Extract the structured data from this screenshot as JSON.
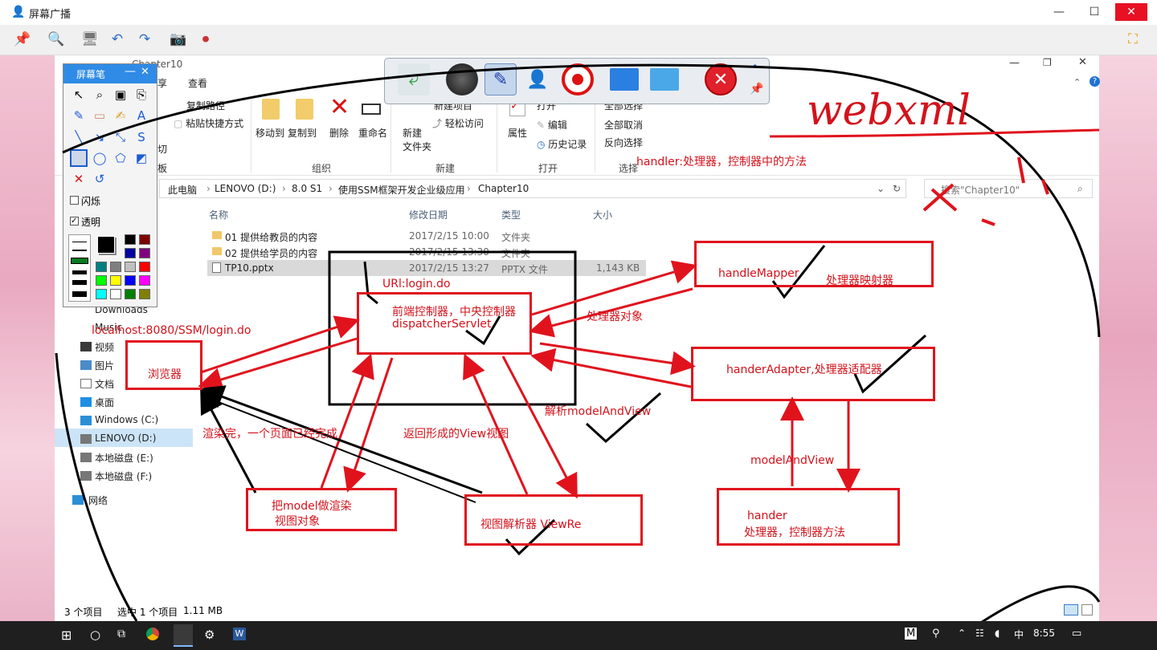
{
  "app": {
    "title": "屏幕广播"
  },
  "window_controls": {
    "minimize": "—",
    "maximize": "☐",
    "close": "✕"
  },
  "broadcast_toolbar": {
    "icons": [
      "pin-icon",
      "zoom-icon",
      "monitor-icon",
      "undo-icon",
      "redo-icon",
      "camera-icon",
      "record-screen-icon"
    ]
  },
  "explorer": {
    "path_title": "Chapter10",
    "tabs": [
      "享",
      "查看"
    ],
    "ribbon": {
      "copy_path": "复制路径",
      "paste_shortcut": "粘贴快捷方式",
      "cut": "切",
      "board": "板",
      "move_to": "移动到",
      "copy_to": "复制到",
      "delete": "删除",
      "rename": "重命名",
      "new_folder": "新建\n文件夹",
      "new_item": "新建项目",
      "easy_access": "轻松访问",
      "properties": "属性",
      "open": "打开",
      "edit": "编辑",
      "history": "历史记录",
      "select_all": "全部选择",
      "select_none": "全部取消",
      "invert": "反向选择",
      "groups": {
        "organize": "组织",
        "new": "新建",
        "open": "打开",
        "select": "选择"
      }
    },
    "breadcrumb": [
      "此电脑",
      "LENOVO (D:)",
      "8.0 S1",
      "使用SSM框架开发企业级应用",
      "Chapter10"
    ],
    "search_placeholder": "搜索\"Chapter10\"",
    "columns": {
      "name": "名称",
      "modified": "修改日期",
      "type": "类型",
      "size": "大小"
    },
    "rows": [
      {
        "name": "01 提供给教员的内容",
        "modified": "2017/2/15 10:00",
        "type": "文件夹",
        "size": ""
      },
      {
        "name": "02 提供给学员的内容",
        "modified": "2017/2/15 13:30",
        "type": "文件夹",
        "size": ""
      },
      {
        "name": "TP10.pptx",
        "modified": "2017/2/15 13:27",
        "type": "PPTX 文件",
        "size": "1,143 KB"
      }
    ],
    "nav": [
      "Downloads",
      "Music",
      "视频",
      "图片",
      "文档",
      "桌面",
      "Windows (C:)",
      "LENOVO (D:)",
      "本地磁盘 (E:)",
      "本地磁盘 (F:)",
      "网络"
    ],
    "status": {
      "count": "3 个项目",
      "selected": "选中 1 个项目",
      "size": "1.11 MB"
    }
  },
  "pen_panel": {
    "title": "屏幕笔",
    "flash_label": "闪烁",
    "transparent_label": "透明",
    "palette": [
      "#000000",
      "#7f0000",
      "#0000a0",
      "#800080",
      "#008080",
      "#808080",
      "#c0c0c0",
      "#ff0000",
      "#00ff00",
      "#ffff00",
      "#0000ff",
      "#ff00ff",
      "#00ffff",
      "#ffffff",
      "#008000",
      "#808000"
    ]
  },
  "annotations": {
    "webxml": "webxml",
    "handler_note": "handler:处理器，控制器中的方法",
    "url": "URl:login.do",
    "front_controller": "前端控制器，中央控制器",
    "dispatcher": "dispatcherServlet",
    "handle_mapper": "handleMapper",
    "mapper_cn": "处理器映射器",
    "handler_object": "处理器对象",
    "localhost": "localhost:8080/SSM/login.do",
    "browser": "浏览器",
    "hander_adapter": "handerAdapter,处理器适配器",
    "parse_mav": "解析modelAndView",
    "render_done": "渲染完，一个页面已经完成",
    "return_view": "返回形成的View视图",
    "model_and_view": "modelAndView",
    "render_model": "把model做渲染",
    "view_object": "视图对象",
    "view_resolver": "视图解析器   ViewRe",
    "hander": "hander",
    "hander_cn": "处理器，控制器方法"
  },
  "taskbar": {
    "time": "8:55",
    "ime": "中",
    "ime_mode": "M"
  },
  "colors": {
    "annotation": "#e0131d",
    "accent": "#2f8be6"
  }
}
